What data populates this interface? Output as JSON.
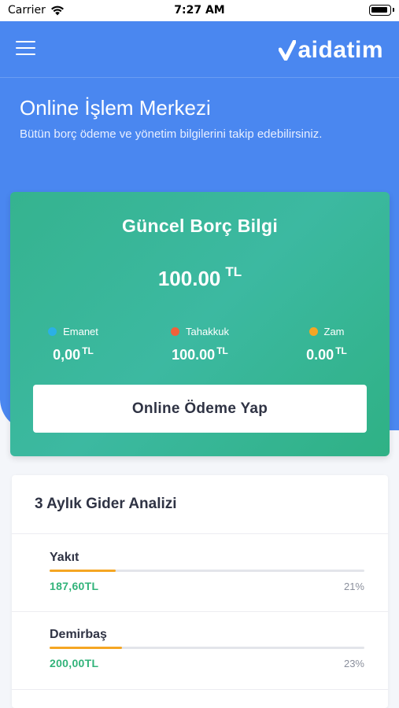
{
  "status_bar": {
    "carrier": "Carrier",
    "time": "7:27 AM"
  },
  "nav": {
    "logo_text": "aidatim",
    "logo_icon": "v-mark-icon",
    "menu_icon": "hamburger-menu-icon"
  },
  "hero": {
    "title": "Online İşlem Merkezi",
    "subtitle": "Bütün borç ödeme ve yönetim bilgilerini takip edebilirsiniz."
  },
  "debt_card": {
    "title": "Güncel Borç Bilgi",
    "amount": "100.00",
    "currency": "TL",
    "breakdown": [
      {
        "label": "Emanet",
        "value": "0,00",
        "unit": "TL",
        "color": "#2bb0e6"
      },
      {
        "label": "Tahakkuk",
        "value": "100.00",
        "unit": "TL",
        "color": "#f0613a"
      },
      {
        "label": "Zam",
        "value": "0.00",
        "unit": "TL",
        "color": "#f5a623"
      }
    ],
    "pay_button": "Online Ödeme Yap"
  },
  "analysis": {
    "title": "3 Aylık Gider Analizi",
    "items": [
      {
        "name": "Yakıt",
        "amount": "187,60TL",
        "percent_label": "21%",
        "percent": 21
      },
      {
        "name": "Demirbaş",
        "amount": "200,00TL",
        "percent_label": "23%",
        "percent": 23
      }
    ]
  },
  "colors": {
    "primary_blue": "#4a87f0",
    "card_green": "#35b38f",
    "accent_orange": "#f5a623",
    "amount_green": "#32b37a"
  }
}
